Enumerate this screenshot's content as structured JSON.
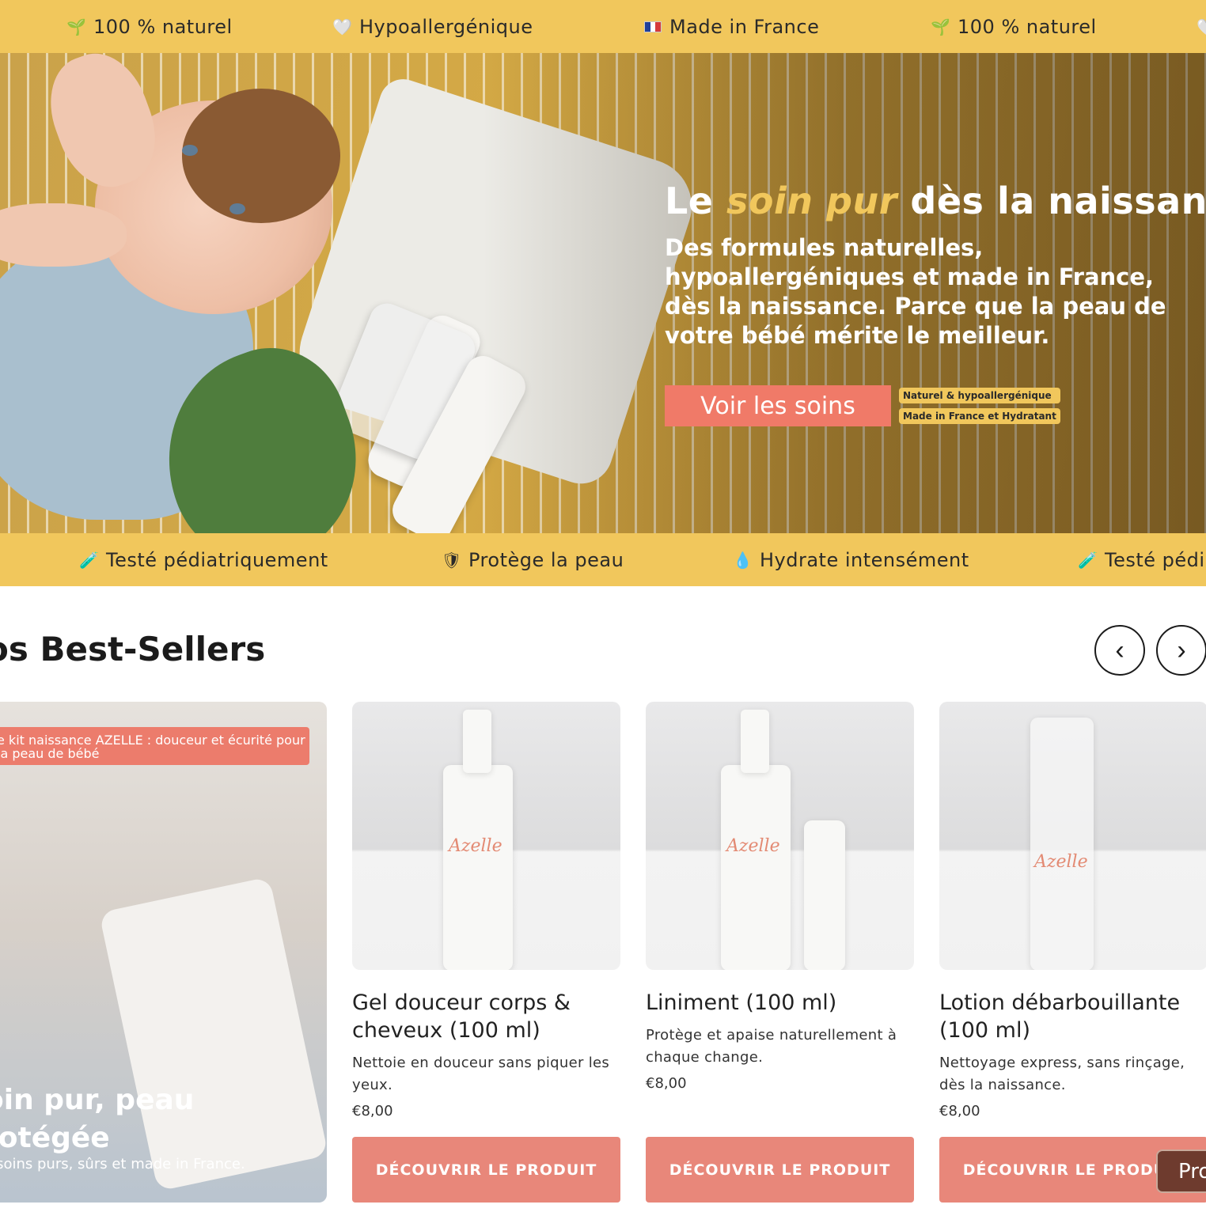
{
  "top_marquee": {
    "items": [
      {
        "icon": "sprout-icon",
        "glyph": "🌱",
        "label": "100 % naturel"
      },
      {
        "icon": "heart-icon",
        "glyph": "🤍",
        "label": "Hypoallergénique"
      },
      {
        "icon": "france-flag-icon",
        "glyph": "",
        "label": "Made in France"
      },
      {
        "icon": "sprout-icon",
        "glyph": "🌱",
        "label": "100 % naturel"
      }
    ]
  },
  "hero": {
    "title_prefix": "Le ",
    "title_accent": "soin pur",
    "title_suffix": " dès la naissance",
    "subtitle": "Des formules naturelles, hypoallergéniques et made in France, dès la naissance. Parce que la peau de votre bébé mérite le meilleur.",
    "cta_label": "Voir les soins",
    "chips": [
      "Naturel & hypoallergénique",
      "Made in France et Hydratant"
    ],
    "accent_color": "#f1c75c",
    "cta_color": "#f07a68"
  },
  "bottom_marquee": {
    "items": [
      {
        "icon": "test-tube-icon",
        "glyph": "🧪",
        "label": "Testé pédiatriquement"
      },
      {
        "icon": "shield-icon",
        "glyph": "🛡",
        "label": "Protège la peau"
      },
      {
        "icon": "droplet-icon",
        "glyph": "💧",
        "label": "Hydrate intensément"
      },
      {
        "icon": "test-tube-icon",
        "glyph": "🧪",
        "label": "Testé pédi"
      }
    ]
  },
  "bestsellers": {
    "title": "os Best-Sellers",
    "prev_glyph": "‹",
    "next_glyph": "›",
    "promo": {
      "label": "e kit naissance AZELLE : douceur et écurité pour la peau de bébé",
      "title": "oin pur, peau rotégée",
      "subtitle": "s soins purs, sûrs et made in France."
    },
    "products": [
      {
        "name": "Gel douceur corps & cheveux (100 ml)",
        "description": "Nettoie en douceur sans piquer les yeux.",
        "price": "€8,00",
        "button": "DÉCOUVRIR LE PRODUIT",
        "brand": "Azelle"
      },
      {
        "name": "Liniment (100 ml)",
        "description": "Protège et apaise naturellement à chaque change.",
        "price": "€8,00",
        "button": "DÉCOUVRIR LE PRODUIT",
        "brand": "Azelle"
      },
      {
        "name": "Lotion débarbouillante (100 ml)",
        "description": "Nettoyage express, sans rinçage, dès la naissance.",
        "price": "€8,00",
        "button": "DÉCOUVRIR LE PRODUIT",
        "brand": "Azelle"
      }
    ],
    "button_color": "#e8877a"
  },
  "floating_button": {
    "label": "Pro"
  }
}
